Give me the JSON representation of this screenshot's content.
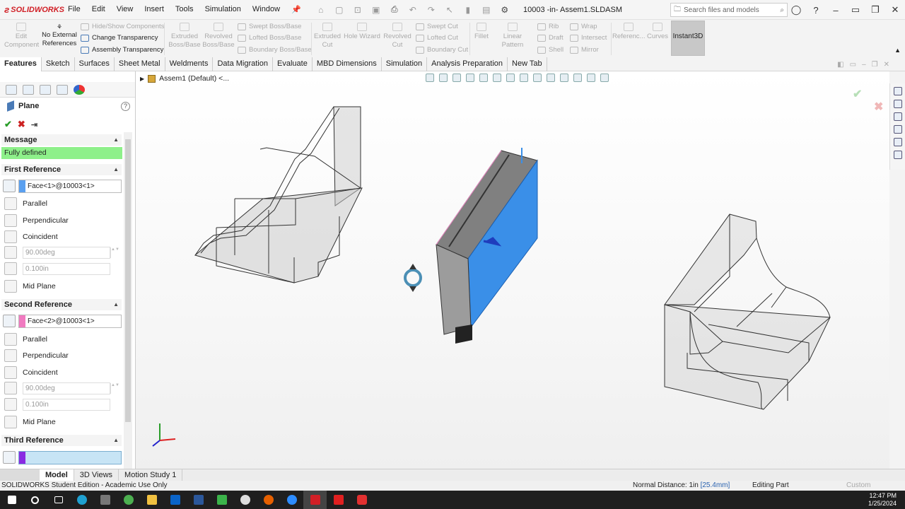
{
  "app": {
    "logo": "SOLIDWORKS",
    "document_title": "10003 -in- Assem1.SLDASM",
    "search_placeholder": "Search files and models"
  },
  "menu": [
    "File",
    "Edit",
    "View",
    "Insert",
    "Tools",
    "Simulation",
    "Window"
  ],
  "commands": {
    "edit_component": "Edit Component",
    "no_external_references": "No External References",
    "hide_show_components": "Hide/Show Components",
    "change_transparency": "Change Transparency",
    "assembly_transparency": "Assembly Transparency",
    "extruded_boss": "Extruded Boss/Base",
    "revolved_boss": "Revolved Boss/Base",
    "swept_boss": "Swept Boss/Base",
    "lofted_boss": "Lofted Boss/Base",
    "boundary_boss": "Boundary Boss/Base",
    "extruded_cut": "Extruded Cut",
    "hole_wizard": "Hole Wizard",
    "revolved_cut": "Revolved Cut",
    "swept_cut": "Swept Cut",
    "lofted_cut": "Lofted Cut",
    "boundary_cut": "Boundary Cut",
    "fillet": "Fillet",
    "linear_pattern": "Linear Pattern",
    "rib": "Rib",
    "draft": "Draft",
    "shell": "Shell",
    "wrap": "Wrap",
    "intersect": "Intersect",
    "mirror": "Mirror",
    "reference": "Referenc...",
    "curves": "Curves",
    "instant3d": "Instant3D"
  },
  "tabs": [
    "Features",
    "Sketch",
    "Surfaces",
    "Sheet Metal",
    "Weldments",
    "Data Migration",
    "Evaluate",
    "MBD Dimensions",
    "Simulation",
    "Analysis Preparation",
    "New Tab"
  ],
  "property_manager": {
    "title": "Plane",
    "message_header": "Message",
    "message": "Fully defined",
    "first_ref_header": "First Reference",
    "first_ref_value": "Face<1>@10003<1>",
    "second_ref_header": "Second Reference",
    "second_ref_value": "Face<2>@10003<1>",
    "third_ref_header": "Third Reference",
    "parallel": "Parallel",
    "perpendicular": "Perpendicular",
    "coincident": "Coincident",
    "angle_value": "90.00deg",
    "distance_value": "0.100in",
    "mid_plane": "Mid Plane",
    "first_ref_color": "#5aa0f0",
    "second_ref_color": "#f07ac0",
    "third_ref_color": "#8a2be2"
  },
  "viewport": {
    "tree_label": "Assem1 (Default) <..."
  },
  "bottom_tabs": [
    "Model",
    "3D Views",
    "Motion Study 1"
  ],
  "status": {
    "edition": "SOLIDWORKS Student Edition - Academic Use Only",
    "normal_distance": "Normal Distance: 1in",
    "normal_distance_mm": "[25.4mm]",
    "editing": "Editing Part",
    "custom": "Custom"
  },
  "clock": {
    "time": "12:47 PM",
    "date": "1/25/2024"
  }
}
